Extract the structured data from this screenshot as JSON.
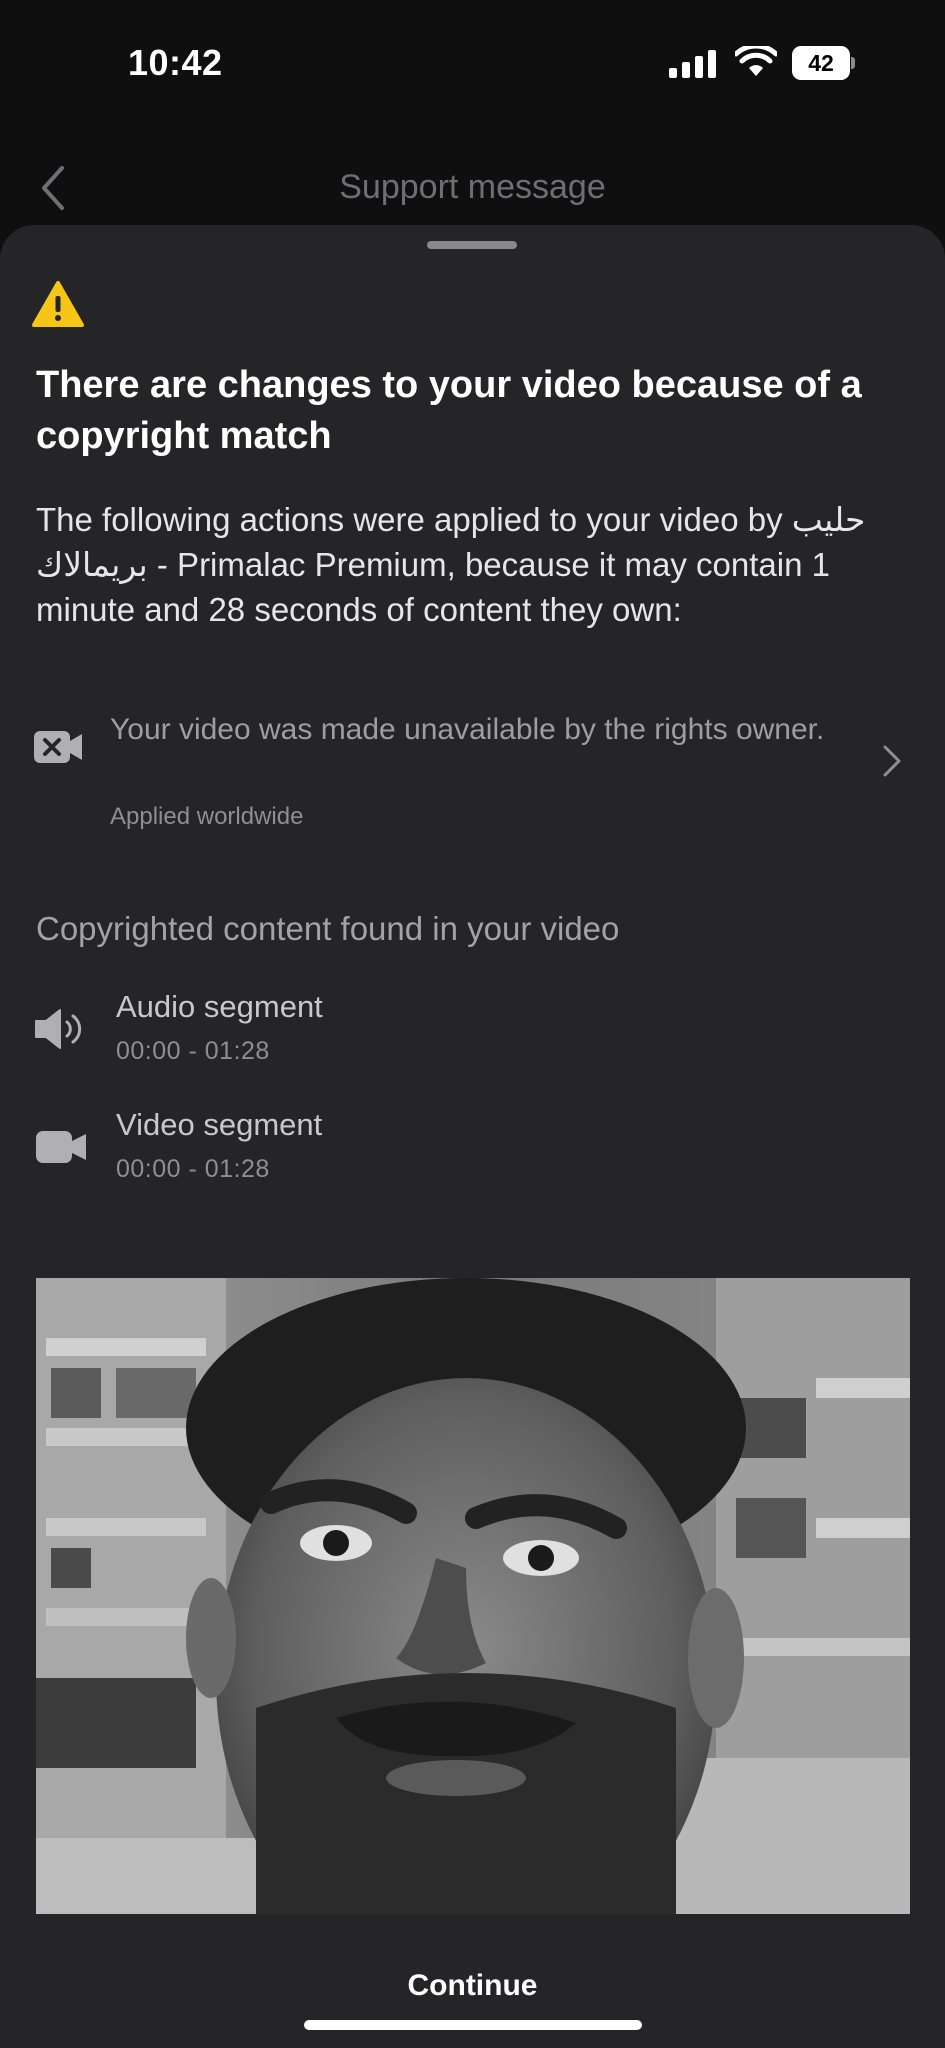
{
  "status_bar": {
    "time": "10:42",
    "battery_level": "42"
  },
  "nav": {
    "title": "Support message",
    "back_icon": "chevron-left-icon"
  },
  "sheet": {
    "warning_icon": "warning-triangle-icon",
    "warning_color": "#f5c518",
    "headline": "There are changes to your video because of a copyright match",
    "body_prefix": "The following actions were applied to your video by ",
    "claimant_arabic": "حليب بريمالاك",
    "body_suffix": " - Primalac Premium, because it may contain 1 minute and 28 seconds of content they own:",
    "action": {
      "icon": "video-blocked-icon",
      "text": "Your video was made unavailable by the rights owner.",
      "subtext": "Applied worldwide"
    },
    "section_title": "Copyrighted content found in your video",
    "segments": [
      {
        "icon": "speaker-icon",
        "label": "Audio segment",
        "time": "00:00 - 01:28"
      },
      {
        "icon": "video-camera-icon",
        "label": "Video segment",
        "time": "00:00 - 01:28"
      }
    ],
    "continue_label": "Continue"
  }
}
